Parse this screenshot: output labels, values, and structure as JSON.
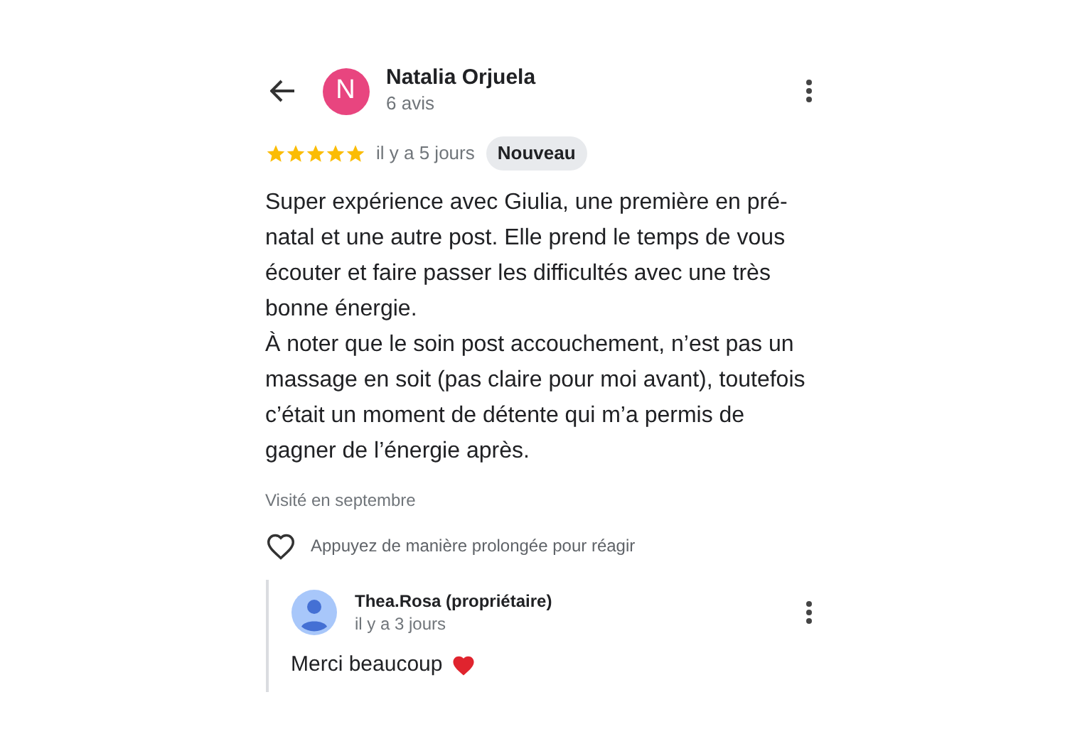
{
  "reviewer": {
    "initial": "N",
    "name": "Natalia Orjuela",
    "count": "6 avis"
  },
  "review": {
    "stars": 5,
    "time": "il y a 5 jours",
    "badge": "Nouveau",
    "paragraphs": [
      "Super expérience avec Giulia, une première en pré-\nnatal et une autre post. Elle prend le temps de vous\nécouter et faire passer les difficultés avec une très\nbonne énergie.",
      "À noter que le soin post accouchement, n’est pas un\nmassage en soit (pas claire pour moi avant), toutefois\nc’était un moment de détente qui m’a permis de\ngagner de l’énergie après."
    ],
    "visited": "Visité en septembre",
    "react_hint": "Appuyez de manière prolongée pour réagir"
  },
  "reply": {
    "name": "Thea.Rosa (propriétaire)",
    "time": "il y a 3 jours",
    "text": "Merci beaucoup"
  }
}
